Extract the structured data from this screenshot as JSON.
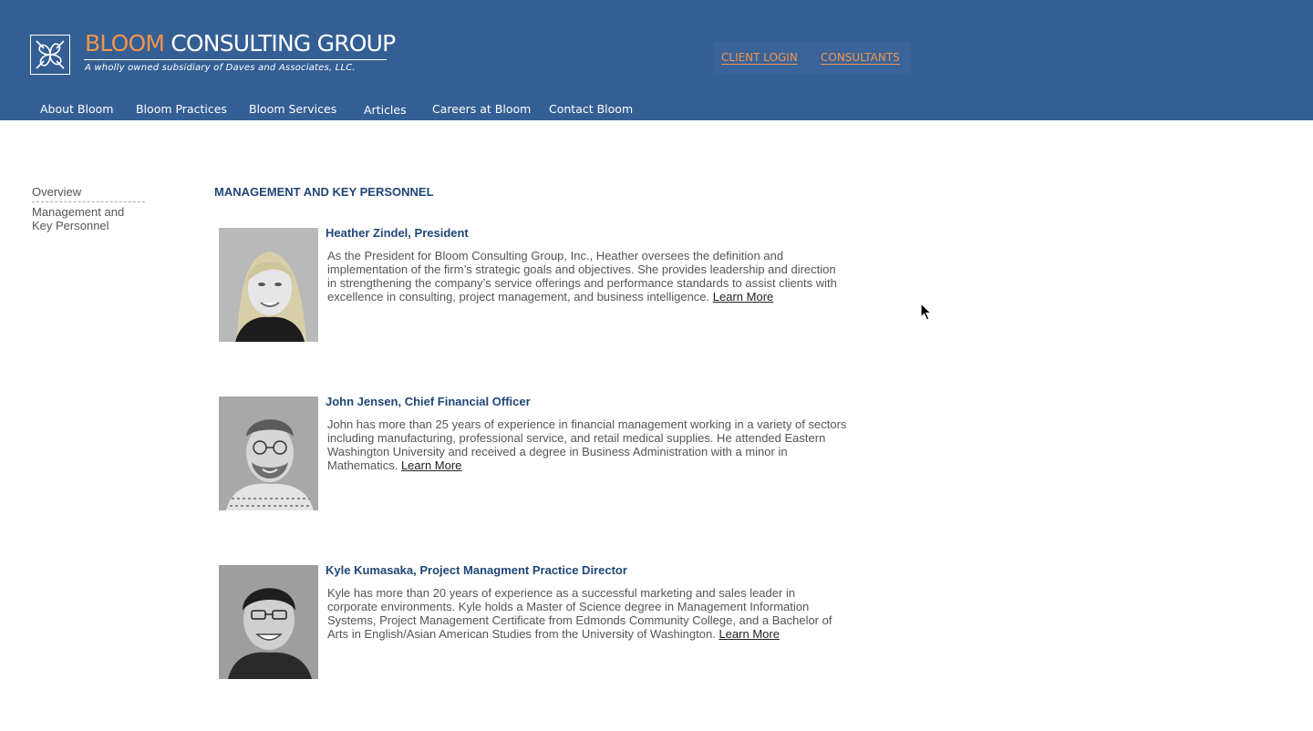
{
  "header": {
    "brand_bloom": "BLOOM",
    "brand_rest": " CONSULTING GROUP",
    "tagline": "A wholly owned subsidiary of Daves and Associates, LLC.",
    "client_login": "CLIENT LOGIN",
    "consultants": "CONSULTANTS"
  },
  "nav": {
    "items": [
      "About Bloom",
      "Bloom Practices",
      "Bloom Services",
      "Articles",
      "Careers at Bloom",
      "Contact Bloom"
    ]
  },
  "sidebar": {
    "items": [
      "Overview",
      "Management and Key Personnel"
    ]
  },
  "main": {
    "title": "MANAGEMENT AND KEY PERSONNEL",
    "learn_more": "Learn More",
    "people": [
      {
        "name": "Heather Zindel, President",
        "bio": "As the President for Bloom Consulting Group, Inc., Heather oversees the definition and implementation of the firm’s strategic goals and objectives. She provides leadership and direction in strengthening the company’s service offerings and performance standards to assist clients with excellence in consulting, project management, and business intelligence."
      },
      {
        "name": "John Jensen, Chief Financial Officer",
        "bio": "John has more than 25 years of experience in financial management working in a variety of sectors including manufacturing, professional service, and retail medical supplies. He attended Eastern Washington University and received a degree in Business Administration with a minor in Mathematics."
      },
      {
        "name": "Kyle Kumasaka, Project Managment Practice Director",
        "bio": "Kyle has more than 20 years of experience as a successful marketing and sales leader in corporate environments. Kyle holds a Master of Science degree in Management Information Systems, Project Management Certificate from Edmonds Community College, and a Bachelor of Arts in English/Asian American Studies from the University of Washington."
      }
    ]
  },
  "colors": {
    "header_bg": "#345f94",
    "accent_orange": "#f0954a",
    "heading_blue": "#1f4677"
  }
}
